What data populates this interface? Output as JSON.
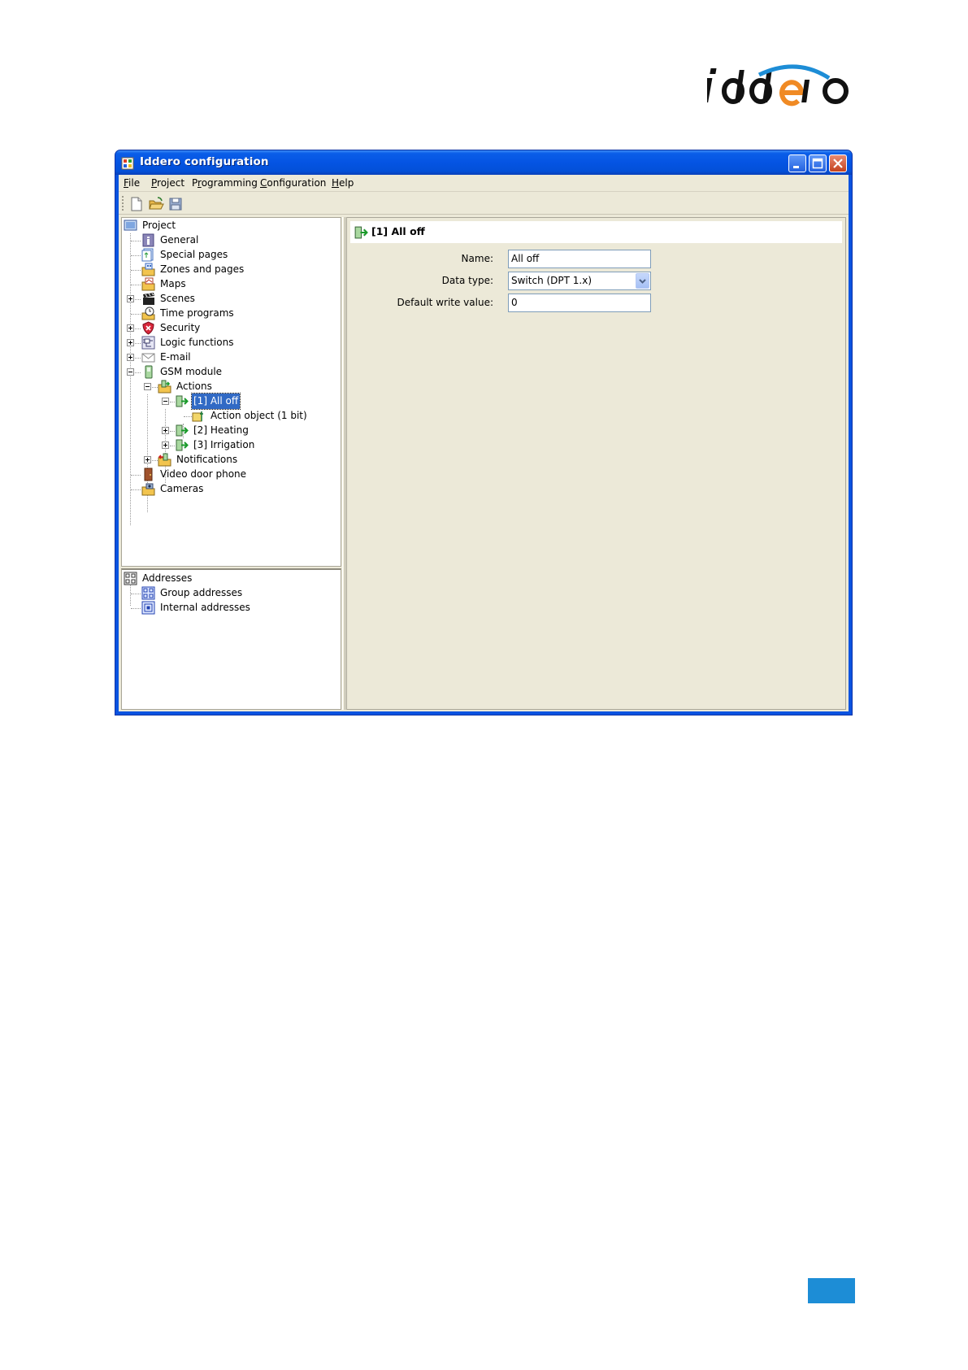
{
  "brand": {
    "logo_text": "iddero",
    "colors": {
      "logo_dark": "#111111",
      "logo_accent_orange": "#f08a24",
      "logo_accent_blue": "#1d8dd6"
    }
  },
  "window": {
    "title": "Iddero configuration",
    "buttons": {
      "minimize": "minimize-icon",
      "maximize": "maximize-icon",
      "close": "close-icon"
    }
  },
  "menubar": {
    "items": [
      {
        "label": "File",
        "access_key": "F"
      },
      {
        "label": "Project",
        "access_key": "P"
      },
      {
        "label": "Programming",
        "access_key": "r"
      },
      {
        "label": "Configuration",
        "access_key": "C"
      },
      {
        "label": "Help",
        "access_key": "H"
      }
    ]
  },
  "toolbar": {
    "buttons": [
      "new-file-icon",
      "open-folder-icon",
      "save-disk-icon"
    ]
  },
  "project_tree": {
    "root": "Project",
    "items": {
      "general": "General",
      "special_pages": "Special pages",
      "zones_and_pages": "Zones and pages",
      "maps": "Maps",
      "scenes": "Scenes",
      "time_programs": "Time programs",
      "security": "Security",
      "logic_functions": "Logic functions",
      "email": "E-mail",
      "gsm_module": "GSM module",
      "actions": "Actions",
      "action_1": "[1] All off",
      "action_object": "Action object (1 bit)",
      "action_2": "[2] Heating",
      "action_3": "[3] Irrigation",
      "notifications": "Notifications",
      "video_door_phone": "Video door phone",
      "cameras": "Cameras"
    },
    "selected": "[1] All off"
  },
  "addresses_tree": {
    "root": "Addresses",
    "items": {
      "group": "Group addresses",
      "internal": "Internal addresses"
    }
  },
  "detail": {
    "title": "[1] All off",
    "fields": {
      "name_label": "Name:",
      "name_value": "All off",
      "data_type_label": "Data type:",
      "data_type_value": "Switch (DPT 1.x)",
      "default_label": "Default write value:",
      "default_value": "0"
    }
  }
}
